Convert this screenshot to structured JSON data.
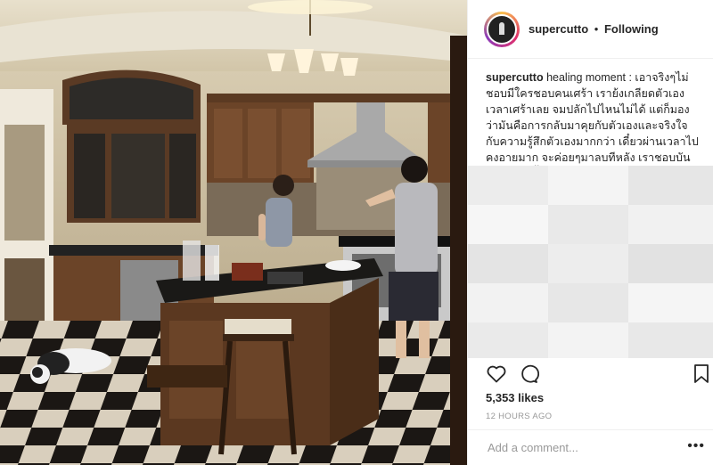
{
  "post": {
    "username": "supercutto",
    "separator": "•",
    "follow_status": "Following",
    "caption_user": "supercutto",
    "caption_text": "healing moment : เอาจริงๆไม่ชอบมีใครชอบคนเศร้า เราย้งเกลียดตัวเองเวลาเศร้าเลย จมปลักไปไหนไม่ได้ แต่ก็มองว่ามันคือการกลับมาคุยกับตัวเองและจริงใจกับความรู้สึกตัวเองมากกว่า เดี๋ยวผ่านเวลาไปคงอายมาก จะค่อยๆมาลบทีหลัง เราชอบบันโน๊ตอะไรทิ้งไว้เพราะมันคือการระบายของเรามากๆเลยแหละ",
    "likes": "5,353 likes",
    "timestamp": "12 HOURS AGO",
    "comment_placeholder": "Add a comment...",
    "more_icon": "•••"
  },
  "icons": {
    "like": "heart-icon",
    "comment": "comment-bubble-icon",
    "save": "bookmark-icon",
    "more": "more-options-icon"
  },
  "colors": {
    "text": "#262626",
    "muted": "#999999",
    "border": "#efefef"
  }
}
